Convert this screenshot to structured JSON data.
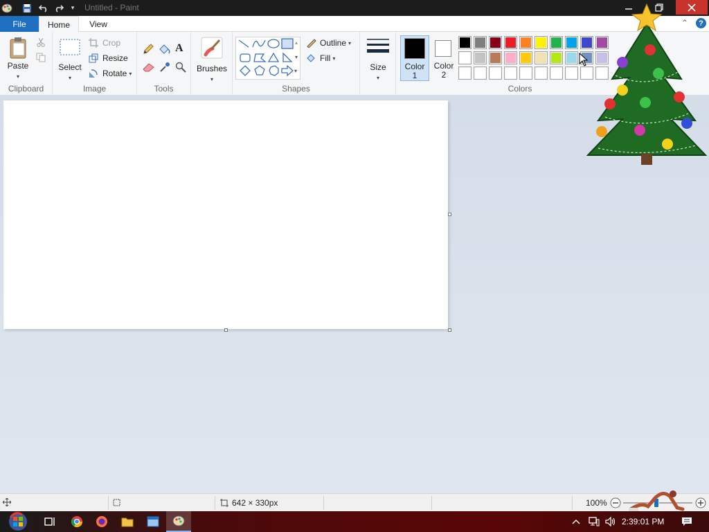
{
  "window": {
    "title": "Untitled - Paint"
  },
  "tabs": {
    "file": "File",
    "home": "Home",
    "view": "View"
  },
  "ribbon": {
    "clipboard": {
      "label": "Clipboard",
      "paste": "Paste"
    },
    "image": {
      "label": "Image",
      "select": "Select",
      "crop": "Crop",
      "resize": "Resize",
      "rotate": "Rotate"
    },
    "tools": {
      "label": "Tools"
    },
    "brushes": {
      "label": "Brushes"
    },
    "shapes": {
      "label": "Shapes",
      "outline": "Outline",
      "fill": "Fill"
    },
    "size": {
      "label": "Size"
    },
    "color1": {
      "line1": "Color",
      "line2": "1"
    },
    "color2": {
      "line1": "Color",
      "line2": "2"
    },
    "colors": {
      "label": "Colors",
      "row1": [
        "#000000",
        "#7f7f7f",
        "#880015",
        "#ed1c24",
        "#ff7f27",
        "#fff200",
        "#22b14c",
        "#00a2e8",
        "#3f48cc",
        "#a349a4"
      ],
      "row2": [
        "#ffffff",
        "#c3c3c3",
        "#b97a57",
        "#ffaec9",
        "#ffc90e",
        "#efe4b0",
        "#b5e61d",
        "#99d9ea",
        "#7092be",
        "#c8bfe7"
      ]
    }
  },
  "status": {
    "size": "642 × 330px",
    "zoom": "100%"
  },
  "taskbar": {
    "clock": "2:39:01 PM"
  }
}
